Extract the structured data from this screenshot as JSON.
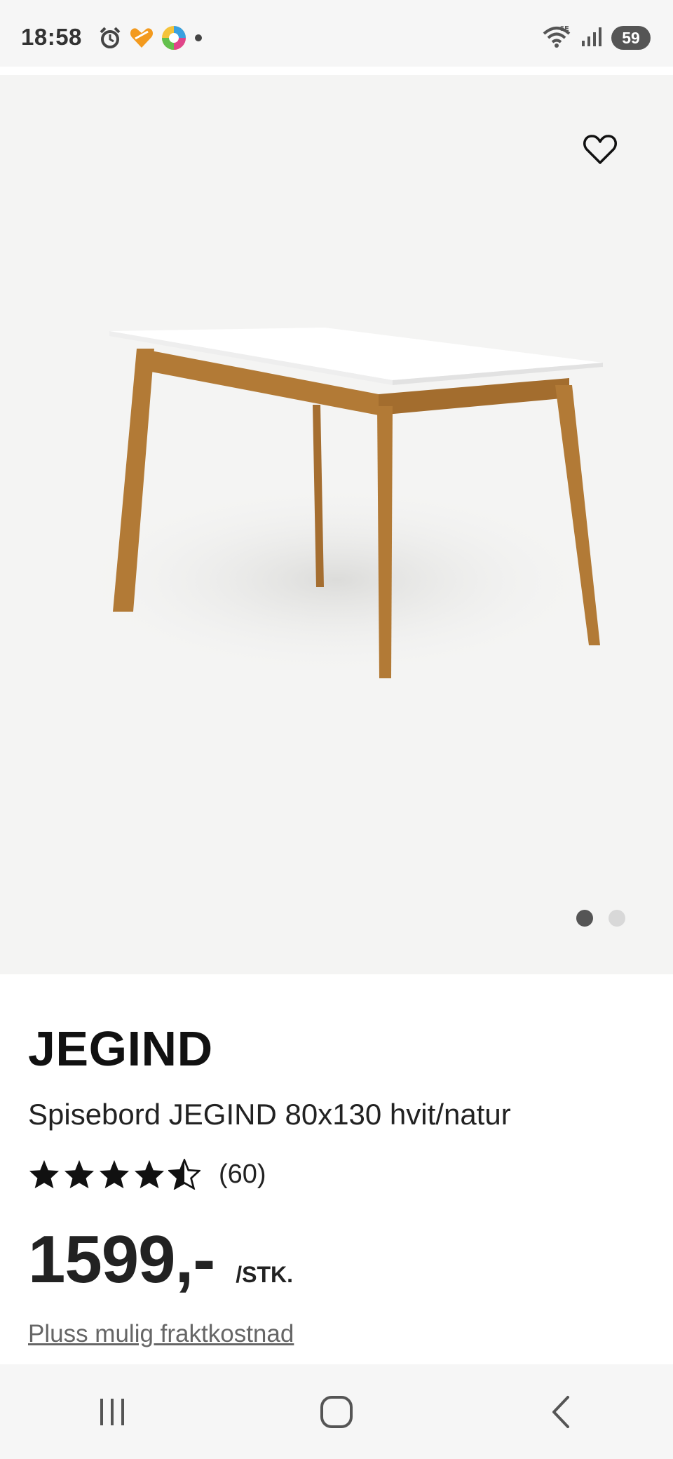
{
  "status_bar": {
    "time": "18:58",
    "battery": "59",
    "icons_left": [
      "alarm-icon",
      "heart-app-icon",
      "colorful-app-icon",
      "dot-icon"
    ],
    "icons_right": [
      "wifi-6e-icon",
      "signal-icon",
      "battery-icon"
    ]
  },
  "gallery": {
    "image_alt": "JEGIND table",
    "slide_count": 2,
    "active_slide": 1,
    "favorite_icon": "heart-outline-icon"
  },
  "product": {
    "brand": "JEGIND",
    "name": "Spisebord JEGIND 80x130 hvit/natur",
    "rating": 4.5,
    "review_count": "(60)",
    "price": "1599,-",
    "unit": "/STK.",
    "shipping_link": "Pluss mulig fraktkostnad"
  },
  "nav": {
    "icons": [
      "recent-apps-icon",
      "home-icon",
      "back-icon"
    ]
  },
  "colors": {
    "gallery_bg": "#f4f4f3",
    "wood": "#b27a36",
    "tabletop": "#ffffff",
    "text": "#111111",
    "dot_active": "#555555",
    "dot_inactive": "#d8d8d8"
  }
}
